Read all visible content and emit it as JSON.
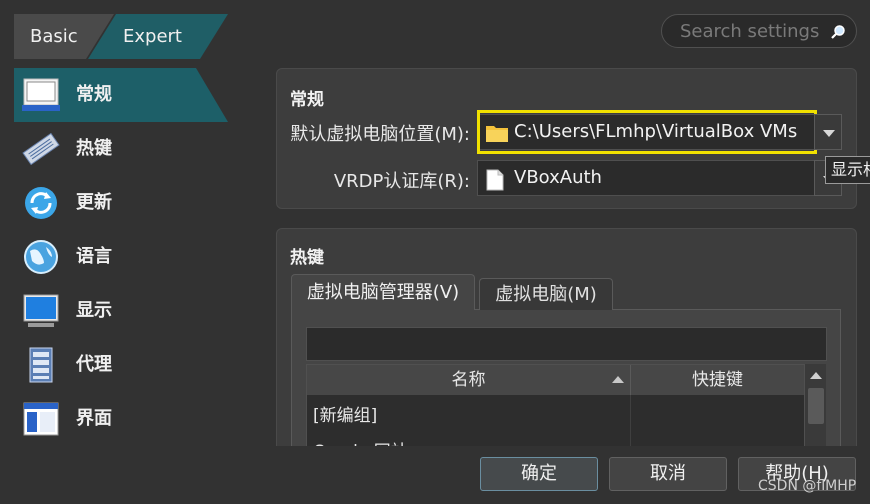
{
  "mode_tabs": {
    "basic": "Basic",
    "expert": "Expert"
  },
  "search": {
    "placeholder": "Search settings"
  },
  "sidebar": {
    "items": [
      {
        "label": "常规",
        "icon": "general-icon"
      },
      {
        "label": "热键",
        "icon": "keyboard-icon"
      },
      {
        "label": "更新",
        "icon": "update-icon"
      },
      {
        "label": "语言",
        "icon": "language-globe-icon"
      },
      {
        "label": "显示",
        "icon": "display-icon"
      },
      {
        "label": "代理",
        "icon": "proxy-icon"
      },
      {
        "label": "界面",
        "icon": "interface-icon"
      }
    ]
  },
  "general": {
    "title": "常规",
    "folder_label": "默认虚拟电脑位置(M):",
    "folder_value": "C:\\Users\\FLmhp\\VirtualBox VMs",
    "vrdp_label": "VRDP认证库(R):",
    "vrdp_value": "VBoxAuth",
    "tooltip": "显示相"
  },
  "hotkeys": {
    "title": "热键",
    "tabs": [
      "虚拟电脑管理器(V)",
      "虚拟电脑(M)"
    ],
    "columns": [
      "名称",
      "快捷键"
    ],
    "rows": [
      "[新编组]",
      "Oracle 网站"
    ]
  },
  "buttons": {
    "ok": "确定",
    "cancel": "取消",
    "help": "帮助(H)"
  },
  "watermark": "CSDN @flMHP",
  "colors": {
    "accent": "#1d5f68",
    "highlight": "#f0e000",
    "background": "#323232"
  }
}
